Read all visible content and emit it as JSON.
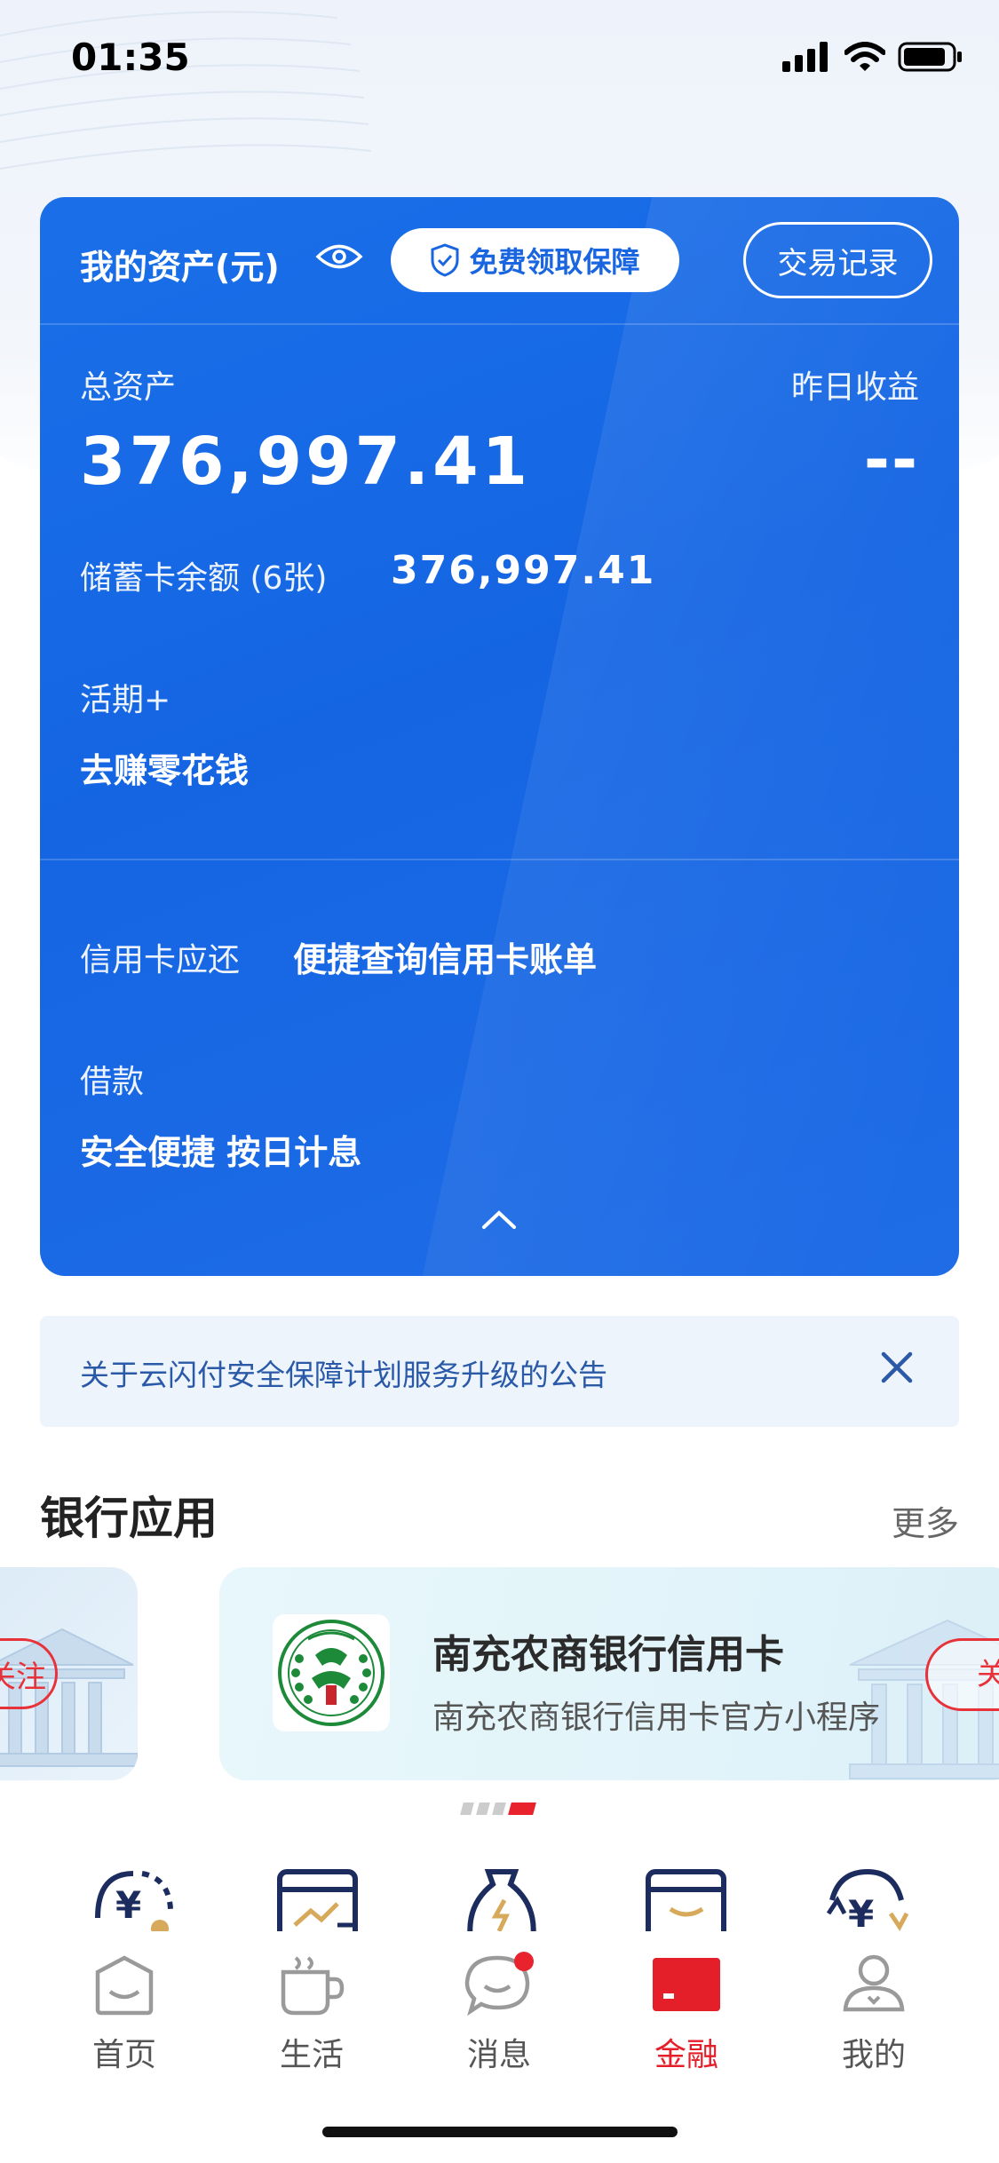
{
  "status_bar": {
    "time": "01:35"
  },
  "assets_card": {
    "title": "我的资产(元)",
    "protect_button": "免费领取保障",
    "records_button": "交易记录",
    "total_label": "总资产",
    "total_amount": "376,997.41",
    "yesterday_label": "昨日收益",
    "yesterday_value": "--",
    "debit_label": "储蓄卡余额 (6张)",
    "debit_amount": "376,997.41",
    "current_label": "活期+",
    "current_action": "去赚零花钱",
    "credit_label": "信用卡应还",
    "credit_action": "便捷查询信用卡账单",
    "loan_label": "借款",
    "loan_action": "安全便捷 按日计息"
  },
  "notice": {
    "text": "关于云闪付安全保障计划服务升级的公告"
  },
  "bank_apps": {
    "title": "银行应用",
    "more": "更多",
    "prev_follow": "关注",
    "card": {
      "name": "南充农商银行信用卡",
      "desc": "南充农商银行信用卡官方小程序",
      "follow": "关注"
    },
    "pager_active_index": 3
  },
  "tabbar": {
    "items": [
      {
        "label": "首页",
        "icon": "home-icon"
      },
      {
        "label": "生活",
        "icon": "cup-icon"
      },
      {
        "label": "消息",
        "icon": "message-icon"
      },
      {
        "label": "金融",
        "icon": "card-icon"
      },
      {
        "label": "我的",
        "icon": "person-icon"
      }
    ],
    "active": "金融"
  },
  "colors": {
    "brand_blue": "#1a6fe8",
    "accent_red": "#e51f2a"
  }
}
